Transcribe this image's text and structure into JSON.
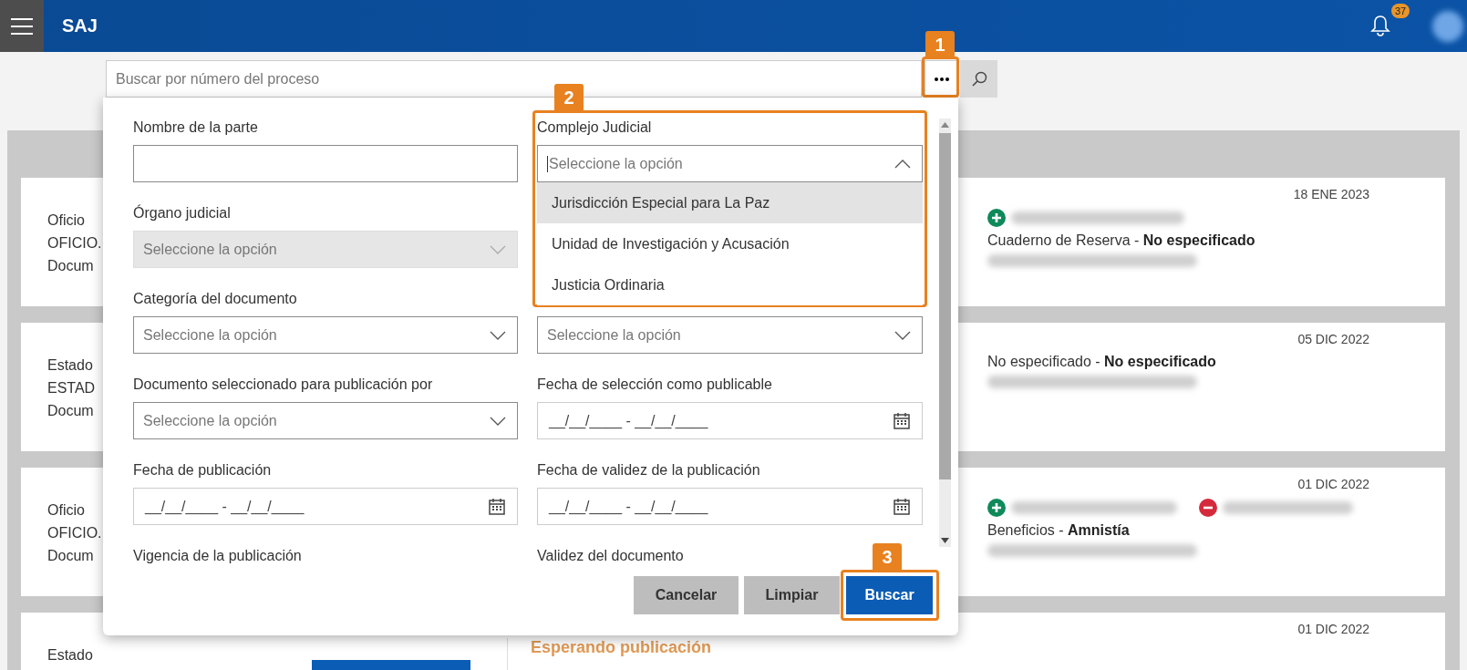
{
  "header": {
    "app_name": "SAJ",
    "notification_count": "37"
  },
  "search": {
    "placeholder": "Buscar por número del proceso"
  },
  "callouts": [
    "1",
    "2",
    "3"
  ],
  "results": [
    {
      "left_lines": [
        "Oficio",
        "OFICIO.",
        "Docum"
      ],
      "date": "18 ENE 2023",
      "markers": [
        {
          "kind": "add"
        }
      ],
      "summary": "Cuaderno de Reserva - **No especificado**"
    },
    {
      "left_lines": [
        "Estado",
        "ESTAD",
        "Docum"
      ],
      "date": "05 DIC 2022",
      "summary": "No especificado - **No especificado**"
    },
    {
      "left_lines": [
        "Oficio",
        "OFICIO.",
        "Docum"
      ],
      "date": "01 DIC 2022",
      "markers": [
        {
          "kind": "add"
        },
        {
          "kind": "remove"
        }
      ],
      "summary": "Beneficios - **Amnistía**"
    },
    {
      "left_lines": [
        "Estado"
      ],
      "date": "01 DIC 2022",
      "status": "Esperando publicación"
    }
  ],
  "filter_panel": {
    "columns": [
      [
        {
          "kind": "text",
          "label": "Nombre de la parte"
        },
        {
          "kind": "select",
          "label": "Órgano judicial",
          "placeholder": "Seleccione la opción",
          "disabled": true,
          "expanded": false
        },
        {
          "kind": "select",
          "label": "Categoría del documento",
          "placeholder": "Seleccione la opción",
          "disabled": false,
          "expanded": false
        },
        {
          "kind": "select",
          "label": "Documento seleccionado para publicación por",
          "placeholder": "Seleccione la opción",
          "disabled": false,
          "expanded": false
        },
        {
          "kind": "date",
          "label": "Fecha de publicación",
          "placeholder": "__/__/____ - __/__/____"
        },
        {
          "kind": "heading",
          "label": "Vigencia de la publicación"
        }
      ],
      [
        {
          "kind": "select",
          "label": "Complejo Judicial",
          "placeholder": "Seleccione la opción",
          "disabled": false,
          "expanded": true,
          "options": [
            {
              "label": "Jurisdicción Especial para La Paz",
              "selected": true
            },
            {
              "label": "Unidad de Investigación y Acusación",
              "selected": false
            },
            {
              "label": "Justicia Ordinaria",
              "selected": false
            }
          ]
        },
        {
          "kind": "select",
          "placeholder": "Seleccione la opción",
          "disabled": false,
          "expanded": false
        },
        {
          "kind": "date",
          "label": "Fecha de selección como publicable",
          "placeholder": "__/__/____ - __/__/____"
        },
        {
          "kind": "date",
          "label": "Fecha de validez de la publicación",
          "placeholder": "__/__/____ - __/__/____"
        },
        {
          "kind": "heading",
          "label": "Validez del documento"
        }
      ]
    ],
    "buttons": [
      {
        "label": "Cancelar",
        "kind": "secondary"
      },
      {
        "label": "Limpiar",
        "kind": "secondary"
      },
      {
        "label": "Buscar",
        "kind": "primary"
      }
    ]
  }
}
